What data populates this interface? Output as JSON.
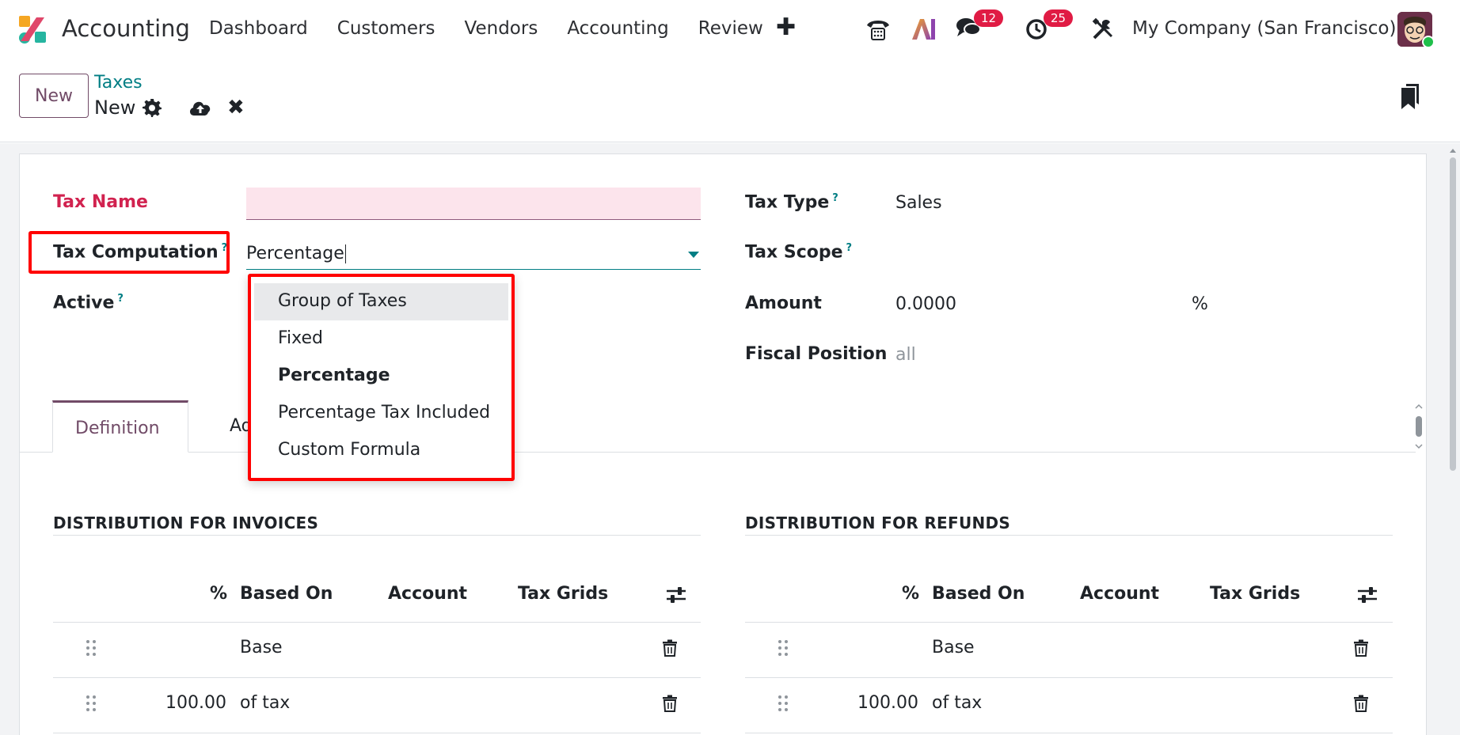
{
  "navbar": {
    "app_name": "Accounting",
    "menu": [
      "Dashboard",
      "Customers",
      "Vendors",
      "Accounting",
      "Review"
    ],
    "discuss_badge": "12",
    "activity_badge": "25",
    "company": "My Company (San Francisco)"
  },
  "control": {
    "new_label": "New",
    "breadcrumb_parent": "Taxes",
    "breadcrumb_current": "New"
  },
  "form": {
    "tax_name_label": "Tax Name",
    "tax_name_value": "",
    "tax_computation_label": "Tax Computation",
    "tax_computation_value": "Percentage",
    "active_label": "Active",
    "tax_type_label": "Tax Type",
    "tax_type_value": "Sales",
    "tax_scope_label": "Tax Scope",
    "amount_label": "Amount",
    "amount_value": "0.0000",
    "amount_unit": "%",
    "fiscal_position_label": "Fiscal Position",
    "fiscal_position_value": "all",
    "help_mark": "?"
  },
  "dropdown": {
    "options": [
      "Group of Taxes",
      "Fixed",
      "Percentage",
      "Percentage Tax Included",
      "Custom Formula"
    ],
    "highlighted": "Group of Taxes",
    "selected": "Percentage"
  },
  "tabs": [
    "Definition",
    "Adva"
  ],
  "invoices": {
    "title": "DISTRIBUTION FOR INVOICES",
    "headers": [
      "%",
      "Based On",
      "Account",
      "Tax Grids"
    ],
    "rows": [
      {
        "percent": "",
        "based_on": "Base"
      },
      {
        "percent": "100.00",
        "based_on": "of tax"
      }
    ]
  },
  "refunds": {
    "title": "DISTRIBUTION FOR REFUNDS",
    "headers": [
      "%",
      "Based On",
      "Account",
      "Tax Grids"
    ],
    "rows": [
      {
        "percent": "",
        "based_on": "Base"
      },
      {
        "percent": "100.00",
        "based_on": "of tax"
      }
    ]
  },
  "colors": {
    "brand": "#714b67",
    "teal": "#017e84",
    "required": "#d1224f",
    "highlight": "#ff0000"
  }
}
